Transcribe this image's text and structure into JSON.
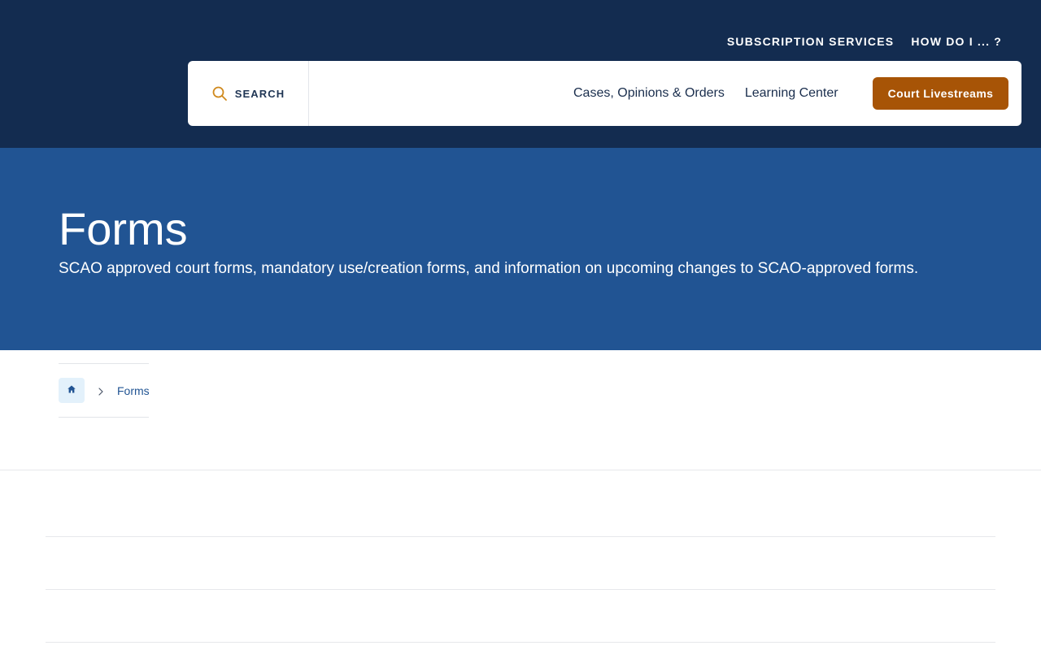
{
  "utility_nav": {
    "subscription": "SUBSCRIPTION SERVICES",
    "how_do_i": "HOW DO I ... ?"
  },
  "search": {
    "label": "SEARCH",
    "icon": "search-icon"
  },
  "main_nav": {
    "items": [
      {
        "label": "Cases, Opinions & Orders"
      },
      {
        "label": "Learning Center"
      }
    ],
    "cta": "Court Livestreams"
  },
  "hero": {
    "title": "Forms",
    "description": "SCAO approved court forms, mandatory use/creation forms, and information on upcoming changes to SCAO-approved forms."
  },
  "breadcrumb": {
    "home_icon": "home-icon",
    "separator_icon": "chevron-right-icon",
    "current": "Forms"
  },
  "colors": {
    "header_bg": "#132c50",
    "hero_bg": "#215493",
    "accent": "#a75406",
    "search_icon": "#d08a1e",
    "breadcrumb_bg": "#e3f1fb"
  }
}
